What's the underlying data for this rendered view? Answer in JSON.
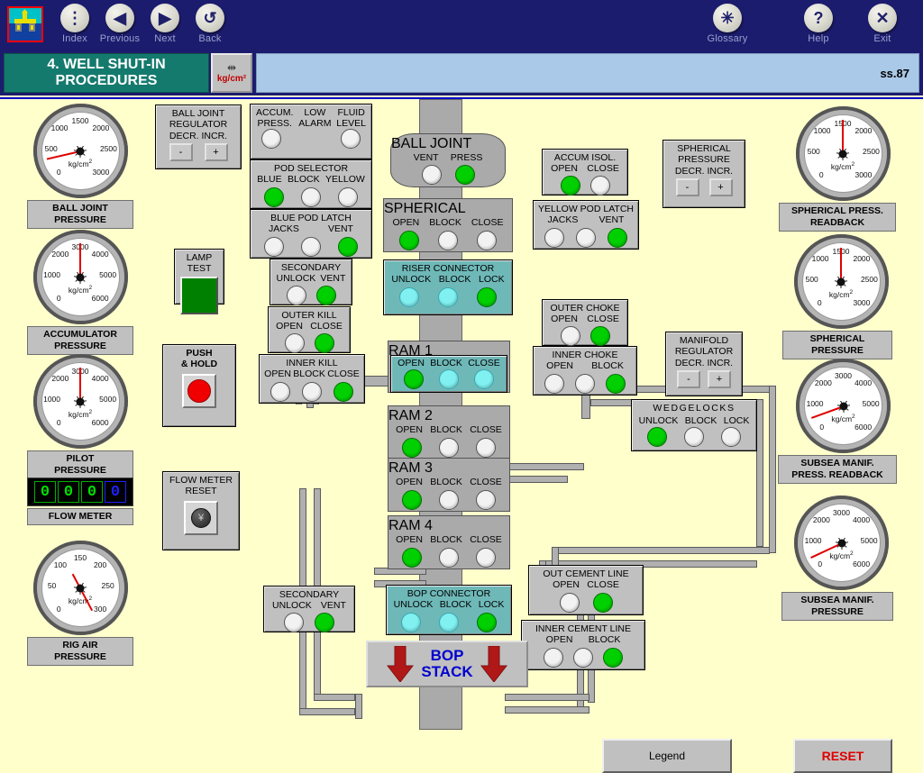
{
  "nav": {
    "logo_alt": "offshore-rig-logo",
    "items": [
      {
        "label": "Index",
        "icon": "vertical-dots-icon"
      },
      {
        "label": "Previous",
        "icon": "left-triangle-icon"
      },
      {
        "label": "Next",
        "icon": "right-triangle-icon"
      },
      {
        "label": "Back",
        "icon": "undo-arrow-icon"
      }
    ],
    "right_items": [
      {
        "label": "Glossary",
        "icon": "compass-icon"
      },
      {
        "label": "Help",
        "icon": "question-mark-icon"
      },
      {
        "label": "Exit",
        "icon": "close-x-icon"
      }
    ]
  },
  "title": {
    "text": "4. WELL SHUT-IN PROCEDURES",
    "line1": "4. WELL SHUT-IN",
    "line2": "PROCEDURES",
    "unit_button": "kg/cm²",
    "unit_icon": "ruler-units-icon",
    "screen_code": "ss.87"
  },
  "colors": {
    "lamp_on": "#00d000",
    "lamp_off": "#f2f2f2",
    "lamp_cyan": "#80f0f0",
    "panel": "#c0c0c0",
    "panel_active": "#6fb8b8",
    "background": "#ffffcc",
    "navbar": "#1c1c6e",
    "title_green": "#157a6e",
    "needle": "#e00000",
    "accent_blue": "#0000d0",
    "accent_red": "#e00000"
  },
  "gauges": [
    {
      "id": "ball-joint-pressure",
      "label_line1": "BALL  JOINT",
      "label_line2": "PRESSURE",
      "unit": "kg/cm",
      "unit_exp": "2",
      "ticks": [
        "0",
        "500",
        "1000",
        "1500",
        "2000",
        "2500",
        "3000"
      ],
      "min": 0,
      "max": 3000,
      "value": 480,
      "needle_deg": -103
    },
    {
      "id": "accumulator-pressure",
      "label_line1": "ACCUMULATOR",
      "label_line2": "PRESSURE",
      "unit": "kg/cm",
      "unit_exp": "2",
      "ticks": [
        "0",
        "1000",
        "2000",
        "3000",
        "4000",
        "5000",
        "6000"
      ],
      "min": 0,
      "max": 6000,
      "value": 3000,
      "needle_deg": 0
    },
    {
      "id": "pilot-pressure",
      "label_line1": "PILOT",
      "label_line2": "PRESSURE",
      "unit": "kg/cm",
      "unit_exp": "2",
      "ticks": [
        "0",
        "1000",
        "2000",
        "3000",
        "4000",
        "5000",
        "6000"
      ],
      "min": 0,
      "max": 6000,
      "value": 3000,
      "needle_deg": 0
    },
    {
      "id": "rig-air-pressure",
      "label_line1": "RIG      AIR",
      "label_line2": "PRESSURE",
      "unit": "kg/cm",
      "unit_exp": "2",
      "ticks": [
        "0",
        "50",
        "100",
        "150",
        "200",
        "250",
        "300"
      ],
      "min": 0,
      "max": 300,
      "value": 115,
      "needle_deg": -28
    },
    {
      "id": "spherical-press-readback",
      "label_line1": "SPHERICAL PRESS.",
      "label_line2": "READBACK",
      "unit": "kg/cm",
      "unit_exp": "2",
      "ticks": [
        "0",
        "500",
        "1000",
        "1500",
        "2000",
        "2500",
        "3000"
      ],
      "min": 0,
      "max": 3000,
      "value": 1500,
      "needle_deg": 0
    },
    {
      "id": "spherical-pressure",
      "label_line1": "SPHERICAL",
      "label_line2": "PRESSURE",
      "unit": "kg/cm",
      "unit_exp": "2",
      "ticks": [
        "0",
        "500",
        "1000",
        "1500",
        "2000",
        "2500",
        "3000"
      ],
      "min": 0,
      "max": 3000,
      "value": 1500,
      "needle_deg": 0
    },
    {
      "id": "subsea-manif-press-readback",
      "label_line1": "SUBSEA MANIF.",
      "label_line2": "PRESS. READBACK",
      "unit": "kg/cm",
      "unit_exp": "2",
      "ticks": [
        "0",
        "1000",
        "2000",
        "3000",
        "4000",
        "5000",
        "6000"
      ],
      "min": 0,
      "max": 6000,
      "value": 1400,
      "needle_deg": -110
    },
    {
      "id": "subsea-manif-pressure",
      "label_line1": "SUBSEA MANIF.",
      "label_line2": "PRESSURE",
      "unit": "kg/cm",
      "unit_exp": "2",
      "ticks": [
        "0",
        "1000",
        "2000",
        "3000",
        "4000",
        "5000",
        "6000"
      ],
      "min": 0,
      "max": 6000,
      "value": 1350,
      "needle_deg": -115
    }
  ],
  "flow_meter": {
    "label": "FLOW METER",
    "digits": [
      "0",
      "0",
      "0"
    ],
    "fraction_digit": "0"
  },
  "regulators": [
    {
      "id": "ball-joint-regulator",
      "lines": [
        "BALL JOINT",
        "REGULATOR",
        "DECR.  INCR."
      ],
      "minus": "-",
      "plus": "+"
    },
    {
      "id": "spherical-pressure-regulator",
      "lines": [
        "SPHERICAL",
        "PRESSURE",
        "DECR.  INCR."
      ],
      "minus": "-",
      "plus": "+"
    },
    {
      "id": "manifold-regulator",
      "lines": [
        "MANIFOLD",
        "REGULATOR",
        "DECR.  INCR."
      ],
      "minus": "-",
      "plus": "+"
    }
  ],
  "lamp_test": {
    "line1": "LAMP",
    "line2": "TEST"
  },
  "push_hold": {
    "line1": "PUSH",
    "line2": "& HOLD",
    "button": "red-round-button"
  },
  "flow_meter_reset": {
    "line1": "FLOW  METER",
    "line2": "RESET",
    "button": "dark-round-knob"
  },
  "panels": [
    {
      "id": "accum-press-alarm",
      "title_left": "ACCUM.\nPRESS.",
      "title_mid": "LOW\nALARM",
      "title_right": "FLUID\nLEVEL",
      "lamps": [
        {
          "name": "accum-press-low-alarm-lamp",
          "state": "off"
        },
        {
          "name": "fluid-level-alarm-lamp",
          "state": "off"
        }
      ]
    },
    {
      "id": "pod-selector",
      "title": "POD SELECTOR",
      "labels": [
        "BLUE",
        "BLOCK",
        "YELLOW"
      ],
      "lamps": [
        {
          "name": "pod-selector-blue-lamp",
          "state": "on"
        },
        {
          "name": "pod-selector-block-lamp",
          "state": "off"
        },
        {
          "name": "pod-selector-yellow-lamp",
          "state": "off"
        }
      ]
    },
    {
      "id": "blue-pod-latch",
      "title": "BLUE POD LATCH",
      "labels": [
        "JACKS",
        "",
        "VENT"
      ],
      "lamps": [
        {
          "name": "blue-pod-latch-jacks-lamp",
          "state": "off"
        },
        {
          "name": "blue-pod-latch-mid-lamp",
          "state": "off"
        },
        {
          "name": "blue-pod-latch-vent-lamp",
          "state": "on"
        }
      ]
    },
    {
      "id": "secondary-unlock-vent-upper",
      "title": "SECONDARY",
      "labels": [
        "UNLOCK",
        "VENT"
      ],
      "lamps": [
        {
          "name": "secondary-unlock-lamp",
          "state": "off"
        },
        {
          "name": "secondary-vent-lamp",
          "state": "on"
        }
      ]
    },
    {
      "id": "outer-kill",
      "title": "OUTER KILL",
      "labels": [
        "OPEN",
        "CLOSE"
      ],
      "lamps": [
        {
          "name": "outer-kill-open-lamp",
          "state": "off"
        },
        {
          "name": "outer-kill-close-lamp",
          "state": "on"
        }
      ]
    },
    {
      "id": "inner-kill",
      "title": "INNER KILL",
      "labels": [
        "OPEN",
        "BLOCK",
        "CLOSE"
      ],
      "lamps": [
        {
          "name": "inner-kill-open-lamp",
          "state": "off"
        },
        {
          "name": "inner-kill-block-lamp",
          "state": "off"
        },
        {
          "name": "inner-kill-close-lamp",
          "state": "on"
        }
      ]
    },
    {
      "id": "accum-isol",
      "title": "ACCUM  ISOL.",
      "labels": [
        "OPEN",
        "CLOSE"
      ],
      "lamps": [
        {
          "name": "accum-isol-open-lamp",
          "state": "on"
        },
        {
          "name": "accum-isol-close-lamp",
          "state": "off"
        }
      ]
    },
    {
      "id": "yellow-pod-latch",
      "title": "YELLOW POD LATCH",
      "labels": [
        "JACKS",
        "",
        "VENT"
      ],
      "lamps": [
        {
          "name": "yellow-pod-latch-jacks-lamp",
          "state": "off"
        },
        {
          "name": "yellow-pod-latch-mid-lamp",
          "state": "off"
        },
        {
          "name": "yellow-pod-latch-vent-lamp",
          "state": "on"
        }
      ]
    },
    {
      "id": "outer-choke",
      "title": "OUTER  CHOKE",
      "labels": [
        "OPEN",
        "CLOSE"
      ],
      "lamps": [
        {
          "name": "outer-choke-open-lamp",
          "state": "off"
        },
        {
          "name": "outer-choke-close-lamp",
          "state": "on"
        }
      ]
    },
    {
      "id": "inner-choke",
      "title": "INNER CHOKE",
      "labels": [
        "OPEN",
        "BLOCK"
      ],
      "lamps": [
        {
          "name": "inner-choke-open-lamp",
          "state": "off"
        },
        {
          "name": "inner-choke-mid-lamp",
          "state": "off"
        },
        {
          "name": "inner-choke-block-lamp",
          "state": "on"
        }
      ]
    },
    {
      "id": "wedgelocks",
      "title": "WEDGELOCKS",
      "labels": [
        "UNLOCK",
        "BLOCK",
        "LOCK"
      ],
      "lamps": [
        {
          "name": "wedgelocks-unlock-lamp",
          "state": "on"
        },
        {
          "name": "wedgelocks-block-lamp",
          "state": "off"
        },
        {
          "name": "wedgelocks-lock-lamp",
          "state": "off"
        }
      ]
    },
    {
      "id": "out-cement-line",
      "title": "OUT CEMENT LINE",
      "labels": [
        "OPEN",
        "CLOSE"
      ],
      "lamps": [
        {
          "name": "out-cement-line-open-lamp",
          "state": "off"
        },
        {
          "name": "out-cement-line-close-lamp",
          "state": "on"
        }
      ]
    },
    {
      "id": "inner-cement-line",
      "title": "INNER CEMENT LINE",
      "labels": [
        "OPEN",
        "BLOCK"
      ],
      "lamps": [
        {
          "name": "inner-cement-line-open-lamp",
          "state": "off"
        },
        {
          "name": "inner-cement-line-mid-lamp",
          "state": "off"
        },
        {
          "name": "inner-cement-line-block-lamp",
          "state": "on"
        }
      ]
    },
    {
      "id": "secondary-unlock-vent-lower",
      "title": "SECONDARY",
      "labels": [
        "UNLOCK",
        "VENT"
      ],
      "lamps": [
        {
          "name": "secondary-lower-unlock-lamp",
          "state": "off"
        },
        {
          "name": "secondary-lower-vent-lamp",
          "state": "on"
        }
      ]
    }
  ],
  "stack": [
    {
      "id": "ball-joint-node",
      "title": "BALL JOINT",
      "labels": [
        "VENT",
        "PRESS"
      ],
      "active": false,
      "lamps": [
        {
          "name": "ball-joint-vent-lamp",
          "state": "off"
        },
        {
          "name": "ball-joint-press-lamp",
          "state": "on"
        }
      ]
    },
    {
      "id": "spherical-node",
      "title": "SPHERICAL",
      "labels": [
        "OPEN",
        "BLOCK",
        "CLOSE"
      ],
      "active": false,
      "lamps": [
        {
          "name": "spherical-open-lamp",
          "state": "on"
        },
        {
          "name": "spherical-block-lamp",
          "state": "off"
        },
        {
          "name": "spherical-close-lamp",
          "state": "off"
        }
      ]
    },
    {
      "id": "riser-connector-node",
      "title": "RISER CONNECTOR",
      "labels": [
        "UNLOCK",
        "BLOCK",
        "LOCK"
      ],
      "active": true,
      "lamps": [
        {
          "name": "riser-connector-unlock-lamp",
          "state": "cyan"
        },
        {
          "name": "riser-connector-block-lamp",
          "state": "cyan"
        },
        {
          "name": "riser-connector-lock-lamp",
          "state": "on"
        }
      ]
    },
    {
      "id": "ram-1-node",
      "title": "RAM 1",
      "labels": [
        "OPEN",
        "BLOCK",
        "CLOSE"
      ],
      "active": true,
      "lamps": [
        {
          "name": "ram-1-open-lamp",
          "state": "on"
        },
        {
          "name": "ram-1-block-lamp",
          "state": "cyan"
        },
        {
          "name": "ram-1-close-lamp",
          "state": "cyan"
        }
      ]
    },
    {
      "id": "ram-2-node",
      "title": "RAM 2",
      "labels": [
        "OPEN",
        "BLOCK",
        "CLOSE"
      ],
      "active": false,
      "lamps": [
        {
          "name": "ram-2-open-lamp",
          "state": "on"
        },
        {
          "name": "ram-2-block-lamp",
          "state": "off"
        },
        {
          "name": "ram-2-close-lamp",
          "state": "off"
        }
      ]
    },
    {
      "id": "ram-3-node",
      "title": "RAM 3",
      "labels": [
        "OPEN",
        "BLOCK",
        "CLOSE"
      ],
      "active": false,
      "lamps": [
        {
          "name": "ram-3-open-lamp",
          "state": "on"
        },
        {
          "name": "ram-3-block-lamp",
          "state": "off"
        },
        {
          "name": "ram-3-close-lamp",
          "state": "off"
        }
      ]
    },
    {
      "id": "ram-4-node",
      "title": "RAM 4",
      "labels": [
        "OPEN",
        "BLOCK",
        "CLOSE"
      ],
      "active": false,
      "lamps": [
        {
          "name": "ram-4-open-lamp",
          "state": "on"
        },
        {
          "name": "ram-4-block-lamp",
          "state": "off"
        },
        {
          "name": "ram-4-close-lamp",
          "state": "off"
        }
      ]
    },
    {
      "id": "bop-connector-node",
      "title": "BOP CONNECTOR",
      "labels": [
        "UNLOCK",
        "BLOCK",
        "LOCK"
      ],
      "active": true,
      "lamps": [
        {
          "name": "bop-connector-unlock-lamp",
          "state": "cyan"
        },
        {
          "name": "bop-connector-block-lamp",
          "state": "cyan"
        },
        {
          "name": "bop-connector-lock-lamp",
          "state": "on"
        }
      ]
    }
  ],
  "bop_stack_button": {
    "line1": "BOP",
    "line2": "STACK",
    "icon": "down-arrow-icon"
  },
  "bottom_buttons": {
    "legend": "Legend",
    "reset": "RESET"
  }
}
